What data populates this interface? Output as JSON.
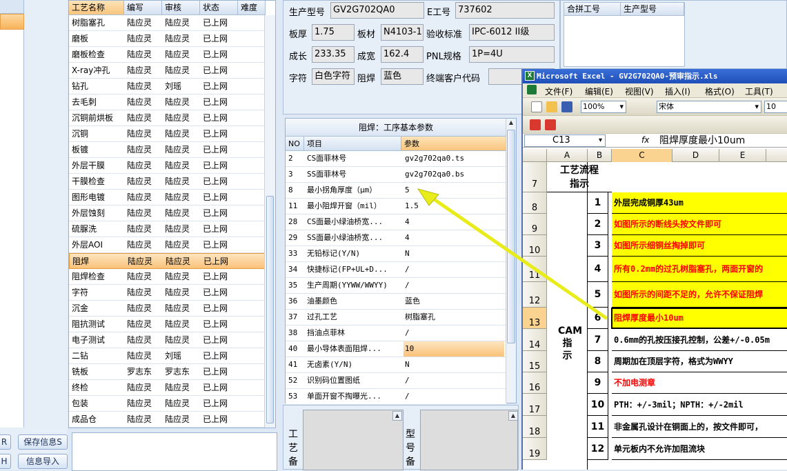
{
  "left_buttons": {
    "save_info": "保存信息S",
    "import_info": "信息导入",
    "btn_r": "R",
    "btn_h": "H"
  },
  "process_table": {
    "columns": [
      "工艺名称",
      "编写",
      "审核",
      "状态",
      "难度"
    ],
    "rows": [
      [
        "树脂塞孔",
        "陆应灵",
        "陆应灵",
        "已上网"
      ],
      [
        "磨板",
        "陆应灵",
        "陆应灵",
        "已上网"
      ],
      [
        "磨板检查",
        "陆应灵",
        "陆应灵",
        "已上网"
      ],
      [
        "X-ray冲孔",
        "陆应灵",
        "陆应灵",
        "已上网"
      ],
      [
        "钻孔",
        "陆应灵",
        "刘瑶",
        "已上网"
      ],
      [
        "去毛刺",
        "陆应灵",
        "陆应灵",
        "已上网"
      ],
      [
        "沉铜前烘板",
        "陆应灵",
        "陆应灵",
        "已上网"
      ],
      [
        "沉铜",
        "陆应灵",
        "陆应灵",
        "已上网"
      ],
      [
        "板镀",
        "陆应灵",
        "陆应灵",
        "已上网"
      ],
      [
        "外层干膜",
        "陆应灵",
        "陆应灵",
        "已上网"
      ],
      [
        "干膜检查",
        "陆应灵",
        "陆应灵",
        "已上网"
      ],
      [
        "图形电镀",
        "陆应灵",
        "陆应灵",
        "已上网"
      ],
      [
        "外层蚀刻",
        "陆应灵",
        "陆应灵",
        "已上网"
      ],
      [
        "硫脲洗",
        "陆应灵",
        "陆应灵",
        "已上网"
      ],
      [
        "外层AOI",
        "陆应灵",
        "陆应灵",
        "已上网"
      ],
      [
        "阻焊",
        "陆应灵",
        "陆应灵",
        "已上网"
      ],
      [
        "阻焊检查",
        "陆应灵",
        "陆应灵",
        "已上网"
      ],
      [
        "字符",
        "陆应灵",
        "陆应灵",
        "已上网"
      ],
      [
        "沉金",
        "陆应灵",
        "陆应灵",
        "已上网"
      ],
      [
        "阻抗测试",
        "陆应灵",
        "陆应灵",
        "已上网"
      ],
      [
        "电子测试",
        "陆应灵",
        "陆应灵",
        "已上网"
      ],
      [
        "二钻",
        "陆应灵",
        "刘瑶",
        "已上网"
      ],
      [
        "铣板",
        "罗志东",
        "罗志东",
        "已上网"
      ],
      [
        "终检",
        "陆应灵",
        "陆应灵",
        "已上网"
      ],
      [
        "包装",
        "陆应灵",
        "陆应灵",
        "已上网"
      ],
      [
        "成品仓",
        "陆应灵",
        "陆应灵",
        "已上网"
      ]
    ],
    "selected_row": "阻焊"
  },
  "info": {
    "model_label": "生产型号",
    "model_value": "GV2G702QA0",
    "eno_label": "E工号",
    "eno_value": "737602",
    "thickness_label": "板厚",
    "thickness_value": "1.75",
    "material_label": "板材",
    "material_value": "N4103-1",
    "standard_label": "验收标准",
    "standard_value": "IPC-6012 II级",
    "length_label": "成长",
    "length_value": "233.35",
    "width_label": "成宽",
    "width_value": "162.4",
    "pnl_label": "PNL规格",
    "pnl_value": "1P=4U",
    "char_label": "字符",
    "char_value": "白色字符",
    "mask_label": "阻焊",
    "mask_value": "蓝色",
    "customer_label": "终端客户代码",
    "customer_value": ""
  },
  "merge": {
    "col1": "合拼工号",
    "col2": "生产型号"
  },
  "params": {
    "title": "阻焊：工序基本参数",
    "columns": [
      "NO",
      "项目",
      "参数"
    ],
    "rows": [
      [
        "2",
        "CS面菲林号",
        "gv2g702qa0.ts"
      ],
      [
        "3",
        "SS面菲林号",
        "gv2g702qa0.bs"
      ],
      [
        "8",
        "最小拐角厚度（μm）",
        "5"
      ],
      [
        "11",
        "最小阻焊开窗（mil）",
        "1.5"
      ],
      [
        "28",
        "CS面最小绿油桥宽...",
        "4"
      ],
      [
        "29",
        "SS面最小绿油桥宽...",
        "4"
      ],
      [
        "33",
        "无铅标记(Y/N)",
        "N"
      ],
      [
        "34",
        "快捷标记(FP+UL+D...",
        "/"
      ],
      [
        "35",
        "生产周期(YYWW/WWYY)",
        "/"
      ],
      [
        "36",
        "油墨颜色",
        "蓝色"
      ],
      [
        "37",
        "过孔工艺",
        "树脂塞孔"
      ],
      [
        "38",
        "挡油点菲林",
        "/"
      ],
      [
        "40",
        "最小导体表面阻焊...",
        "10"
      ],
      [
        "41",
        "无卤素(Y/N)",
        "N"
      ],
      [
        "52",
        "识别码位置图纸",
        "/"
      ],
      [
        "53",
        "单面开窗不掏曝光...",
        "/"
      ]
    ],
    "highlight_row": "40"
  },
  "memo": {
    "label1": "工艺备",
    "label2": "型号备"
  },
  "excel": {
    "title": "Microsoft Excel - GV2G702QA0-预审指示.xls",
    "menus": [
      "文件(F)",
      "编辑(E)",
      "视图(V)",
      "插入(I)",
      "格式(O)",
      "工具(T)"
    ],
    "zoom": "100%",
    "font": "宋体",
    "font_size": "10",
    "cell_ref": "C13",
    "fx": "fx",
    "formula": "阻焊厚度最小10um",
    "columns": [
      "A",
      "B",
      "C",
      "D",
      "E"
    ],
    "header_cell": "工艺流程指示",
    "cam_label": "CAM指示",
    "rows": [
      {
        "r": "7",
        "n": "",
        "text": ""
      },
      {
        "r": "8",
        "n": "1",
        "text": "外层完成铜厚43um"
      },
      {
        "r": "9",
        "n": "2",
        "text": "如图所示的断线头按文件即可"
      },
      {
        "r": "10",
        "n": "3",
        "text": "如图所示细铜丝掏掉即可"
      },
      {
        "r": "11",
        "n": "4",
        "text": "所有0.2mm的过孔树脂塞孔，两面开窗的"
      },
      {
        "r": "12",
        "n": "5",
        "text": "如图所示的间距不足的，允许不保证阻焊"
      },
      {
        "r": "13",
        "n": "6",
        "text": "阻焊厚度最小10um"
      },
      {
        "r": "14",
        "n": "7",
        "text": "0.6mm的孔按压接孔控制，公差+/-0.05m"
      },
      {
        "r": "15",
        "n": "8",
        "text": "周期加在顶层字符，格式为WWYY"
      },
      {
        "r": "16",
        "n": "9",
        "text": "不加电测章"
      },
      {
        "r": "17",
        "n": "10",
        "text": "PTH：+/-3mil；NPTH：+/-2mil"
      },
      {
        "r": "18",
        "n": "11",
        "text": "非金属孔设计在铜面上的，按文件即可，"
      },
      {
        "r": "19",
        "n": "12",
        "text": "单元板内不允许加阻流块"
      }
    ]
  },
  "colors": {
    "selection": "#f8b35a",
    "highlight_yellow": "#ffff00",
    "red_text": "#ff0000",
    "arrow": "#e8ec1a"
  }
}
